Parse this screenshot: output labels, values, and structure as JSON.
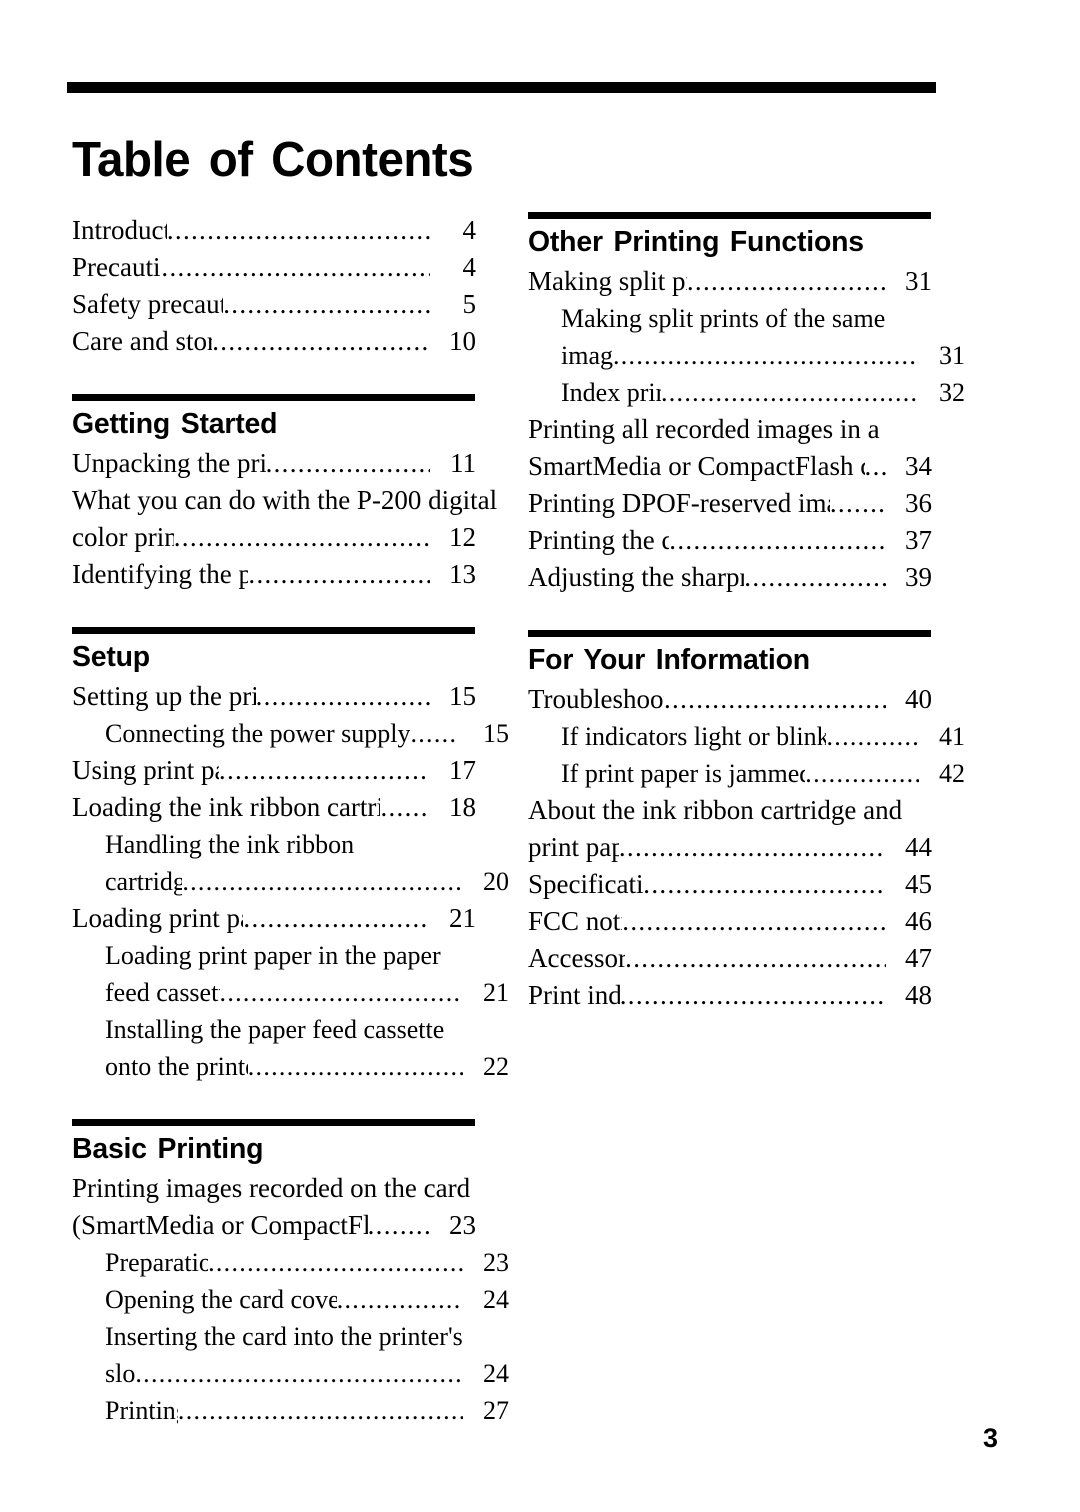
{
  "document": {
    "title": "Table of Contents",
    "page_number": "3"
  },
  "left_column": {
    "intro_entries": [
      {
        "label": "Introduction",
        "leader": "..............................................",
        "page": "4"
      },
      {
        "label": "Precautions",
        "leader": "...............................................",
        "page": "4"
      },
      {
        "label": "Safety precautions",
        "leader": "..................................",
        "page": "5"
      },
      {
        "label": "Care and storage",
        "leader": "...................................",
        "page": "10"
      }
    ],
    "sections": [
      {
        "heading": "Getting Started",
        "entries": [
          {
            "label": "Unpacking the printer",
            "leader": ".........................",
            "page": "11"
          },
          {
            "wrap_lines": [
              "What you can do with the P-200 digital"
            ],
            "label": "color printer",
            "leader": "..........................................",
            "page": "12"
          },
          {
            "label": "Identifying the parts",
            "leader": "............................",
            "page": "13"
          }
        ]
      },
      {
        "heading": "Setup",
        "entries": [
          {
            "label": "Setting up the printer",
            "leader": "...........................",
            "page": "15"
          },
          {
            "sub": true,
            "label": "Connecting the power supply",
            "leader": "......",
            "page": "15"
          },
          {
            "label": "Using print packs",
            "leader": "..................................",
            "page": "17"
          },
          {
            "label": "Loading the ink ribbon cartridge",
            "leader": ".......",
            "page": "18"
          },
          {
            "sub": true,
            "wrap_lines": [
              "Handling the ink ribbon"
            ],
            "label": "cartridge",
            "leader": "...........................................",
            "page": "20"
          },
          {
            "label": "Loading print paper",
            "leader": ".............................",
            "page": "21"
          },
          {
            "sub": true,
            "wrap_lines": [
              "Loading print paper in the paper"
            ],
            "label": "feed cassette",
            "leader": "....................................",
            "page": "21"
          },
          {
            "sub": true,
            "wrap_lines": [
              "Installing the paper feed cassette"
            ],
            "label": "onto the printer",
            "leader": "...............................",
            "page": "22"
          }
        ]
      },
      {
        "heading": "Basic Printing",
        "entries": [
          {
            "wrap_lines": [
              "Printing images recorded on the card"
            ],
            "label": "(SmartMedia or CompactFlash)",
            "leader": ".........",
            "page": "23"
          },
          {
            "sub": true,
            "label": "Preparation",
            "leader": "......................................",
            "page": "23"
          },
          {
            "sub": true,
            "label": "Opening the card cover",
            "leader": ".................",
            "page": "24"
          },
          {
            "sub": true,
            "wrap_lines": [
              "Inserting the card into the printer's"
            ],
            "label": "slot",
            "leader": "....................................................",
            "page": "24"
          },
          {
            "sub": true,
            "label": "Printing",
            "leader": "..........................................",
            "page": "27"
          }
        ]
      }
    ]
  },
  "right_column": {
    "sections": [
      {
        "heading": "Other Printing Functions",
        "entries": [
          {
            "label": "Making split prints",
            "leader": "................................",
            "page": "31"
          },
          {
            "sub": true,
            "wrap_lines": [
              "Making split prints of the same"
            ],
            "label": "image",
            "leader": "................................................",
            "page": "31"
          },
          {
            "sub": true,
            "label": "Index print",
            "leader": "......................................",
            "page": "32"
          },
          {
            "wrap_lines": [
              "Printing all recorded images in a"
            ],
            "label": "SmartMedia or CompactFlash card",
            "leader": "...",
            "page": "34"
          },
          {
            "label": "Printing DPOF-reserved images",
            "leader": "........",
            "page": "36"
          },
          {
            "label": "Printing the date",
            "leader": "..................................",
            "page": "37"
          },
          {
            "label": "Adjusting the sharpness",
            "leader": ".....................",
            "page": "39"
          }
        ]
      },
      {
        "heading": "For Your Information",
        "entries": [
          {
            "label": "Troubleshooting",
            "leader": "....................................",
            "page": "40"
          },
          {
            "sub": true,
            "label": "If indicators light or blink",
            "leader": "............",
            "page": "41"
          },
          {
            "sub": true,
            "label": "If print paper is jammed",
            "leader": "...............",
            "page": "42"
          },
          {
            "wrap_lines": [
              "About the ink ribbon cartridge and"
            ],
            "label": "print paper",
            "leader": "...........................................",
            "page": "44"
          },
          {
            "label": "Specifications",
            "leader": "........................................",
            "page": "45"
          },
          {
            "label": "FCC notice",
            "leader": "...........................................",
            "page": "46"
          },
          {
            "label": "Accessories",
            "leader": "...........................................",
            "page": "47"
          },
          {
            "label": "Print index",
            "leader": "...........................................",
            "page": "48"
          }
        ]
      }
    ]
  }
}
